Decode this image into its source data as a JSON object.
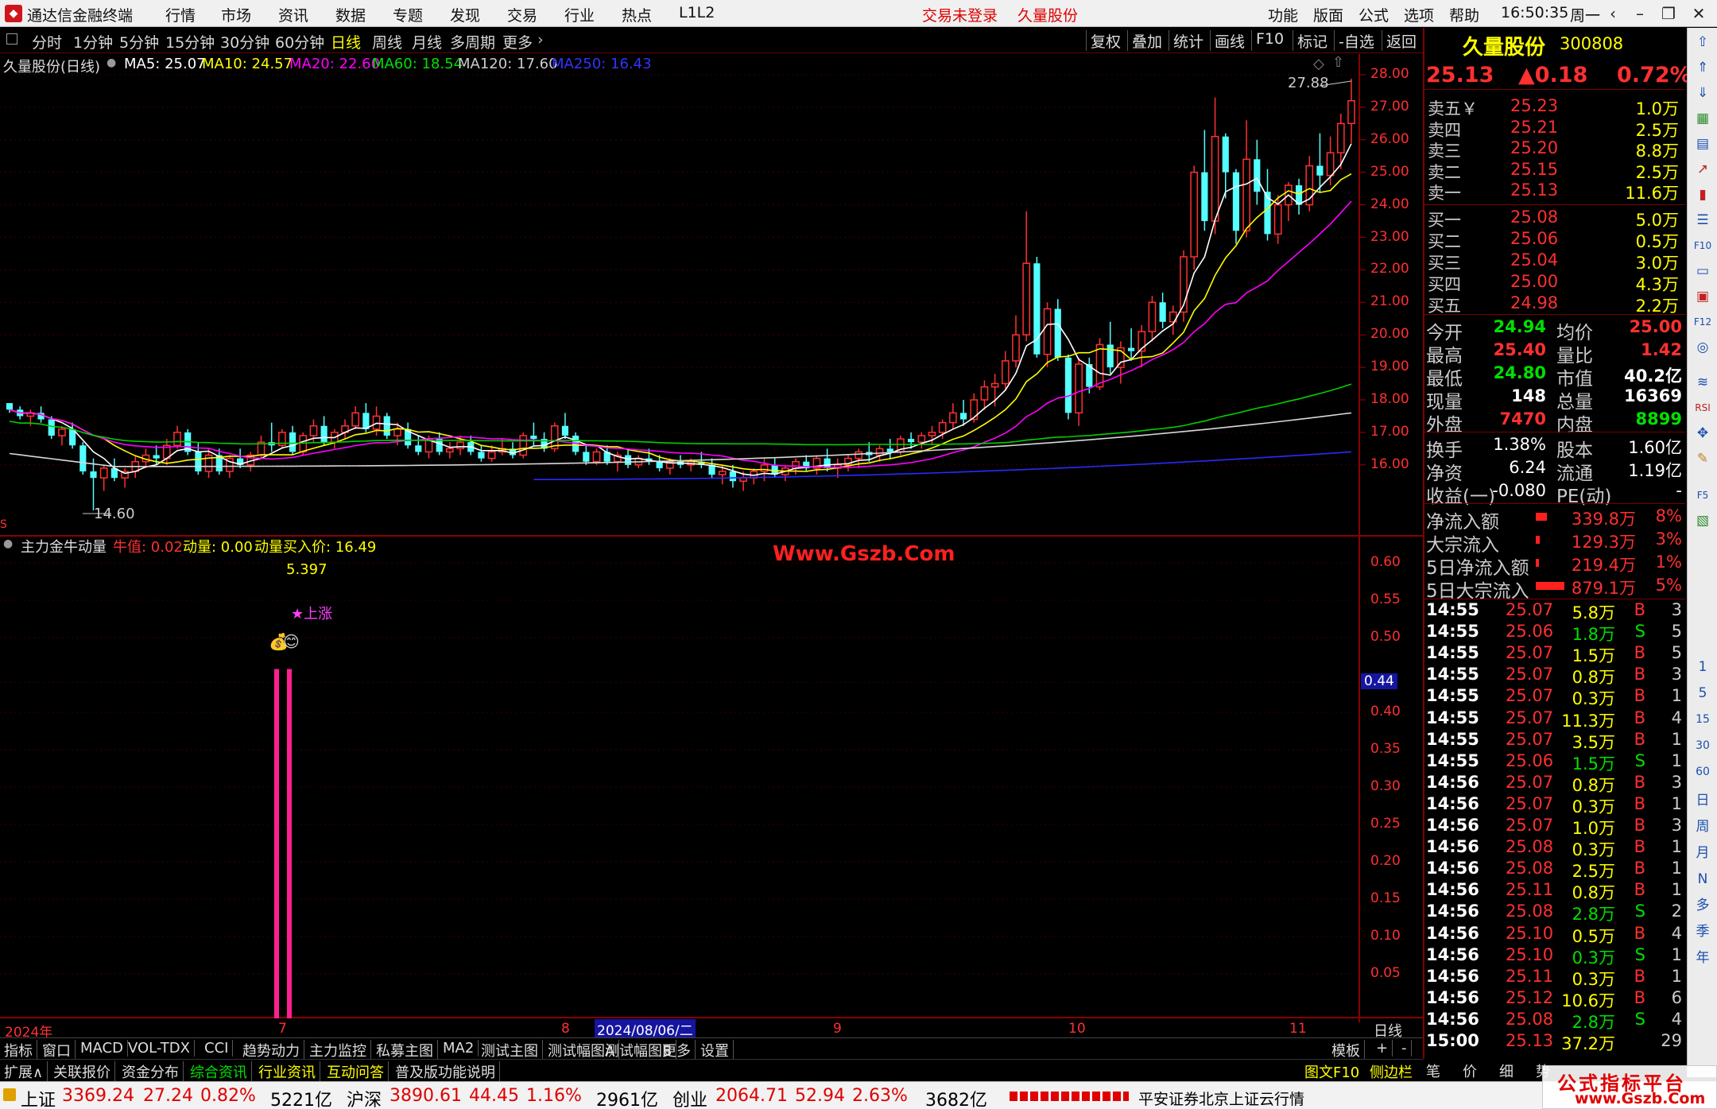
{
  "app": {
    "title": "通达信金融终端",
    "menu": [
      "行情",
      "市场",
      "资讯",
      "数据",
      "专题",
      "发现",
      "交易",
      "行业",
      "热点",
      "L1L2"
    ],
    "trade_status": "交易未登录",
    "stock_name_top": "久量股份",
    "right_menu": [
      "功能",
      "版面",
      "公式",
      "选项",
      "帮助"
    ],
    "time": "16:50:35",
    "weekday": "周一"
  },
  "toolbar": {
    "periods": [
      "分时",
      "1分钟",
      "5分钟",
      "15分钟",
      "30分钟",
      "60分钟",
      "日线",
      "周线",
      "月线",
      "多周期",
      "更多"
    ],
    "active_period": "日线",
    "right_buttons": [
      "复权",
      "叠加",
      "统计",
      "画线",
      "F10",
      "标记",
      "-自选",
      "返回"
    ]
  },
  "chart": {
    "header_name": "久量股份(日线)",
    "ma": [
      {
        "label": "MA5: 25.07",
        "color": "#ffffff"
      },
      {
        "label": "MA10: 24.57",
        "color": "#ffff00"
      },
      {
        "label": "MA20: 22.60",
        "color": "#ff00ff"
      },
      {
        "label": "MA60: 18.54",
        "color": "#00e000"
      },
      {
        "label": "MA120: 17.60",
        "color": "#cccccc"
      },
      {
        "label": "MA250: 16.43",
        "color": "#3333ff"
      }
    ],
    "high_label": "27.88",
    "low_label": "14.60",
    "price_axis": [
      "28.00",
      "27.00",
      "26.00",
      "25.00",
      "24.00",
      "23.00",
      "22.00",
      "21.00",
      "20.00",
      "19.00",
      "18.00",
      "17.00",
      "16.00"
    ],
    "indicator_name": "主力金牛动量",
    "indicator_items": [
      {
        "label": "牛值: 0.02",
        "color": "#ff3030"
      },
      {
        "label": "动量: 0.00",
        "color": "#ffff00"
      },
      {
        "label": "动量买入价: 16.49",
        "color": "#ffff00"
      }
    ],
    "indicator_value_top": "5.397",
    "signal_text": "★上涨",
    "watermark": "Www.Gszb.Com",
    "indicator_axis": [
      "0.60",
      "0.55",
      "0.50",
      "0.44",
      "0.40",
      "0.35",
      "0.30",
      "0.25",
      "0.20",
      "0.15",
      "0.10",
      "0.05"
    ],
    "indicator_current": "0.44",
    "date_axis": [
      "2024年",
      "7",
      "8",
      "9",
      "10",
      "11"
    ],
    "date_cursor": "2024/08/06/二",
    "period_label": "日线"
  },
  "quote": {
    "name": "久量股份",
    "code": "300808",
    "price": "25.13",
    "change": "▲0.18",
    "change_pct": "0.72%",
    "asks": [
      {
        "label": "卖五￥",
        "price": "25.23",
        "vol": "1.0万"
      },
      {
        "label": "卖四",
        "price": "25.21",
        "vol": "2.5万"
      },
      {
        "label": "卖三",
        "price": "25.20",
        "vol": "8.8万"
      },
      {
        "label": "卖二",
        "price": "25.15",
        "vol": "2.5万"
      },
      {
        "label": "卖一",
        "price": "25.13",
        "vol": "11.6万"
      }
    ],
    "bids": [
      {
        "label": "买一",
        "price": "25.08",
        "vol": "5.0万"
      },
      {
        "label": "买二",
        "price": "25.06",
        "vol": "0.5万"
      },
      {
        "label": "买三",
        "price": "25.04",
        "vol": "3.0万"
      },
      {
        "label": "买四",
        "price": "25.00",
        "vol": "4.3万"
      },
      {
        "label": "买五",
        "price": "24.98",
        "vol": "2.2万"
      }
    ],
    "stats": [
      {
        "k1": "今开",
        "v1": "24.94",
        "c1": "#00e000",
        "k2": "均价",
        "v2": "25.00",
        "c2": "#ff3030"
      },
      {
        "k1": "最高",
        "v1": "25.40",
        "c1": "#ff3030",
        "k2": "量比",
        "v2": "1.42",
        "c2": "#ff3030"
      },
      {
        "k1": "最低",
        "v1": "24.80",
        "c1": "#00e000",
        "k2": "市值",
        "v2": "40.2亿",
        "c2": "#ffffff"
      },
      {
        "k1": "现量",
        "v1": "148",
        "c1": "#ffffff",
        "k2": "总量",
        "v2": "16369",
        "c2": "#ffffff"
      },
      {
        "k1": "外盘",
        "v1": "7470",
        "c1": "#ff3030",
        "k2": "内盘",
        "v2": "8899",
        "c2": "#00e000"
      }
    ],
    "stats2": [
      {
        "k1": "换手",
        "v1": "1.38%",
        "k2": "股本",
        "v2": "1.60亿"
      },
      {
        "k1": "净资",
        "v1": "6.24",
        "k2": "流通",
        "v2": "1.19亿"
      },
      {
        "k1": "收益(一)",
        "v1": "-0.080",
        "k2": "PE(动)",
        "v2": "-"
      }
    ],
    "flows": [
      {
        "label": "净流入额",
        "value": "339.8万",
        "pct": "8%",
        "bar": 0.24
      },
      {
        "label": "大宗流入",
        "value": "129.3万",
        "pct": "3%",
        "bar": 0.09
      },
      {
        "label": "5日净流入额",
        "value": "219.4万",
        "pct": "1%",
        "bar": 0.03
      },
      {
        "label": "5日大宗流入",
        "value": "879.1万",
        "pct": "5%",
        "bar": 0.6
      }
    ],
    "ticks": [
      {
        "t": "14:55",
        "p": "25.07",
        "v": "5.8万",
        "s": "B",
        "n": "3"
      },
      {
        "t": "14:55",
        "p": "25.06",
        "v": "1.8万",
        "s": "S",
        "n": "5"
      },
      {
        "t": "14:55",
        "p": "25.07",
        "v": "1.5万",
        "s": "B",
        "n": "5"
      },
      {
        "t": "14:55",
        "p": "25.07",
        "v": "0.8万",
        "s": "B",
        "n": "3"
      },
      {
        "t": "14:55",
        "p": "25.07",
        "v": "0.3万",
        "s": "B",
        "n": "1"
      },
      {
        "t": "14:55",
        "p": "25.07",
        "v": "11.3万",
        "s": "B",
        "n": "4"
      },
      {
        "t": "14:55",
        "p": "25.07",
        "v": "3.5万",
        "s": "B",
        "n": "1"
      },
      {
        "t": "14:55",
        "p": "25.06",
        "v": "1.5万",
        "s": "S",
        "n": "1"
      },
      {
        "t": "14:56",
        "p": "25.07",
        "v": "0.8万",
        "s": "B",
        "n": "3"
      },
      {
        "t": "14:56",
        "p": "25.07",
        "v": "0.3万",
        "s": "B",
        "n": "1"
      },
      {
        "t": "14:56",
        "p": "25.07",
        "v": "1.0万",
        "s": "B",
        "n": "3"
      },
      {
        "t": "14:56",
        "p": "25.08",
        "v": "0.3万",
        "s": "B",
        "n": "1"
      },
      {
        "t": "14:56",
        "p": "25.08",
        "v": "2.5万",
        "s": "B",
        "n": "1"
      },
      {
        "t": "14:56",
        "p": "25.11",
        "v": "0.8万",
        "s": "B",
        "n": "1"
      },
      {
        "t": "14:56",
        "p": "25.08",
        "v": "2.8万",
        "s": "S",
        "n": "2"
      },
      {
        "t": "14:56",
        "p": "25.10",
        "v": "0.5万",
        "s": "B",
        "n": "4"
      },
      {
        "t": "14:56",
        "p": "25.10",
        "v": "0.3万",
        "s": "S",
        "n": "1"
      },
      {
        "t": "14:56",
        "p": "25.11",
        "v": "0.3万",
        "s": "B",
        "n": "1"
      },
      {
        "t": "14:56",
        "p": "25.12",
        "v": "10.6万",
        "s": "B",
        "n": "6"
      },
      {
        "t": "14:56",
        "p": "25.08",
        "v": "2.8万",
        "s": "S",
        "n": "4"
      },
      {
        "t": "15:00",
        "p": "25.13",
        "v": "37.2万",
        "s": "",
        "n": "29"
      }
    ]
  },
  "vtools": [
    "日",
    "周",
    "月",
    "N",
    "多",
    "季",
    "年",
    "1",
    "5",
    "15",
    "30",
    "60"
  ],
  "tabs1": [
    "指标",
    "窗口",
    "MACD",
    "VOL-TDX",
    "CCI",
    "趋势动力",
    "主力监控",
    "私募主图",
    "MA2",
    "测试主图",
    "测试幅图A",
    "测试幅图B",
    "更多",
    "设置"
  ],
  "tabs1_right": [
    "模板",
    "+",
    "-"
  ],
  "tabs2": [
    "扩展∧",
    "关联报价",
    "资金分布",
    "综合资讯",
    "行业资讯",
    "互动问答",
    "普及版功能说明"
  ],
  "tabs2_right": [
    "图文F10",
    "侧边栏《",
    "笔",
    "价",
    "细",
    "势"
  ],
  "status": {
    "sh_label": "上证",
    "sh_val": "3369.24",
    "sh_chg": "27.24",
    "sh_pct": "0.82%",
    "sh_amt": "5221亿",
    "hs_label": "沪深",
    "hs_val": "3890.61",
    "hs_chg": "44.45",
    "hs_pct": "1.16%",
    "hs_amt": "2961亿",
    "cy_label": "创业",
    "cy_val": "2064.71",
    "cy_chg": "52.94",
    "cy_pct": "2.63%",
    "cy_amt": "3682亿",
    "broker": "平安证券北京上证云行情",
    "site_title": "公式指标平台",
    "site_url": "www.Gszb.Com"
  },
  "chart_data": {
    "type": "candlestick",
    "ylim": [
      14.5,
      28.2
    ],
    "ohlc": [
      [
        17.9,
        17.9,
        17.6,
        17.7
      ],
      [
        17.7,
        17.8,
        17.4,
        17.5
      ],
      [
        17.5,
        17.7,
        17.2,
        17.6
      ],
      [
        17.6,
        17.8,
        17.3,
        17.4
      ],
      [
        17.4,
        17.5,
        16.8,
        16.9
      ],
      [
        16.9,
        17.2,
        16.6,
        17.1
      ],
      [
        17.1,
        17.3,
        16.5,
        16.6
      ],
      [
        16.6,
        16.7,
        15.7,
        15.8
      ],
      [
        15.8,
        16.2,
        14.6,
        15.6
      ],
      [
        15.6,
        16.0,
        15.2,
        15.9
      ],
      [
        15.9,
        16.2,
        15.5,
        15.6
      ],
      [
        15.6,
        15.9,
        15.3,
        15.8
      ],
      [
        15.8,
        16.3,
        15.6,
        16.1
      ],
      [
        16.1,
        16.5,
        15.9,
        16.3
      ],
      [
        16.3,
        16.6,
        16.0,
        16.2
      ],
      [
        16.2,
        16.8,
        16.0,
        16.6
      ],
      [
        16.6,
        17.2,
        16.5,
        17.0
      ],
      [
        17.0,
        17.1,
        16.3,
        16.4
      ],
      [
        16.4,
        16.7,
        15.7,
        15.8
      ],
      [
        15.8,
        16.5,
        15.6,
        16.3
      ],
      [
        16.3,
        16.5,
        15.7,
        15.8
      ],
      [
        15.8,
        16.3,
        15.6,
        16.2
      ],
      [
        16.2,
        16.5,
        15.9,
        16.0
      ],
      [
        16.0,
        16.4,
        15.8,
        16.3
      ],
      [
        16.3,
        16.9,
        16.2,
        16.7
      ],
      [
        16.7,
        17.3,
        16.4,
        16.6
      ],
      [
        16.6,
        17.1,
        16.5,
        17.0
      ],
      [
        17.0,
        17.2,
        16.3,
        16.4
      ],
      [
        16.4,
        17.0,
        16.3,
        16.9
      ],
      [
        16.9,
        17.4,
        16.7,
        17.2
      ],
      [
        17.2,
        17.5,
        16.6,
        16.7
      ],
      [
        16.7,
        17.1,
        16.5,
        17.0
      ],
      [
        17.0,
        17.4,
        16.8,
        17.2
      ],
      [
        17.2,
        17.8,
        17.1,
        17.6
      ],
      [
        17.6,
        17.9,
        17.0,
        17.1
      ],
      [
        17.1,
        17.8,
        16.9,
        17.5
      ],
      [
        17.5,
        17.6,
        16.8,
        16.9
      ],
      [
        16.9,
        17.3,
        16.6,
        17.1
      ],
      [
        17.1,
        17.3,
        16.5,
        16.6
      ],
      [
        16.6,
        16.9,
        16.3,
        16.4
      ],
      [
        16.4,
        16.9,
        16.2,
        16.8
      ],
      [
        16.8,
        17.0,
        16.3,
        16.4
      ],
      [
        16.4,
        16.7,
        16.2,
        16.5
      ],
      [
        16.5,
        16.9,
        16.3,
        16.7
      ],
      [
        16.7,
        16.9,
        16.3,
        16.4
      ],
      [
        16.4,
        16.6,
        16.1,
        16.2
      ],
      [
        16.2,
        16.6,
        16.1,
        16.4
      ],
      [
        16.4,
        16.8,
        16.3,
        16.5
      ],
      [
        16.5,
        16.7,
        16.2,
        16.3
      ],
      [
        16.3,
        17.0,
        16.2,
        16.9
      ],
      [
        16.9,
        17.3,
        16.6,
        16.8
      ],
      [
        16.8,
        17.0,
        16.4,
        16.5
      ],
      [
        16.5,
        17.3,
        16.4,
        17.2
      ],
      [
        17.2,
        17.6,
        16.8,
        16.9
      ],
      [
        16.9,
        17.0,
        16.3,
        16.4
      ],
      [
        16.4,
        16.6,
        16.0,
        16.1
      ],
      [
        16.1,
        16.5,
        16.0,
        16.4
      ],
      [
        16.4,
        16.6,
        16.0,
        16.1
      ],
      [
        16.1,
        16.4,
        15.8,
        16.3
      ],
      [
        16.3,
        16.5,
        15.9,
        16.0
      ],
      [
        16.0,
        16.3,
        15.9,
        16.2
      ],
      [
        16.2,
        16.5,
        16.0,
        16.1
      ],
      [
        16.1,
        16.3,
        15.8,
        15.9
      ],
      [
        15.9,
        16.2,
        15.7,
        16.1
      ],
      [
        16.1,
        16.3,
        15.9,
        16.0
      ],
      [
        16.0,
        16.2,
        15.8,
        16.1
      ],
      [
        16.1,
        16.4,
        15.9,
        16.0
      ],
      [
        16.0,
        16.2,
        15.6,
        15.7
      ],
      [
        15.7,
        16.0,
        15.4,
        15.8
      ],
      [
        15.8,
        16.0,
        15.3,
        15.5
      ],
      [
        15.5,
        15.8,
        15.2,
        15.6
      ],
      [
        15.6,
        15.9,
        15.4,
        15.8
      ],
      [
        15.8,
        16.2,
        15.5,
        16.0
      ],
      [
        16.0,
        16.2,
        15.6,
        15.7
      ],
      [
        15.7,
        16.0,
        15.5,
        15.9
      ],
      [
        15.9,
        16.2,
        15.7,
        16.1
      ],
      [
        16.1,
        16.3,
        15.8,
        15.9
      ],
      [
        15.9,
        16.3,
        15.7,
        16.2
      ],
      [
        16.2,
        16.5,
        15.8,
        15.9
      ],
      [
        15.9,
        16.2,
        15.6,
        16.0
      ],
      [
        16.0,
        16.3,
        15.8,
        16.2
      ],
      [
        16.2,
        16.5,
        15.9,
        16.4
      ],
      [
        16.4,
        16.7,
        16.1,
        16.3
      ],
      [
        16.3,
        16.6,
        16.1,
        16.5
      ],
      [
        16.5,
        16.8,
        16.2,
        16.4
      ],
      [
        16.4,
        16.9,
        16.3,
        16.8
      ],
      [
        16.8,
        17.0,
        16.5,
        16.7
      ],
      [
        16.7,
        17.0,
        16.5,
        16.9
      ],
      [
        16.9,
        17.2,
        16.6,
        17.0
      ],
      [
        17.0,
        17.4,
        16.8,
        17.3
      ],
      [
        17.3,
        17.9,
        17.1,
        17.6
      ],
      [
        17.6,
        18.0,
        17.2,
        17.4
      ],
      [
        17.4,
        18.2,
        17.3,
        18.0
      ],
      [
        18.0,
        18.6,
        17.7,
        18.4
      ],
      [
        18.4,
        18.8,
        17.8,
        18.5
      ],
      [
        18.5,
        19.5,
        18.3,
        19.2
      ],
      [
        19.2,
        20.6,
        19.0,
        20.0
      ],
      [
        20.0,
        23.8,
        19.8,
        22.2
      ],
      [
        22.2,
        22.4,
        19.3,
        19.4
      ],
      [
        19.4,
        21.0,
        19.0,
        20.8
      ],
      [
        20.8,
        21.1,
        19.2,
        19.3
      ],
      [
        19.3,
        19.4,
        17.4,
        17.6
      ],
      [
        17.6,
        19.3,
        17.2,
        19.1
      ],
      [
        19.1,
        19.3,
        18.2,
        18.4
      ],
      [
        18.4,
        19.9,
        18.3,
        19.7
      ],
      [
        19.7,
        20.4,
        18.8,
        19.0
      ],
      [
        19.0,
        19.8,
        18.5,
        19.6
      ],
      [
        19.6,
        20.2,
        19.2,
        19.5
      ],
      [
        19.5,
        20.3,
        19.0,
        20.1
      ],
      [
        20.1,
        21.2,
        19.8,
        21.0
      ],
      [
        21.0,
        21.3,
        20.2,
        20.4
      ],
      [
        20.4,
        20.9,
        20.0,
        20.7
      ],
      [
        20.7,
        22.6,
        20.4,
        22.4
      ],
      [
        22.4,
        25.2,
        22.0,
        25.0
      ],
      [
        25.0,
        26.3,
        23.2,
        23.5
      ],
      [
        23.5,
        27.3,
        23.1,
        26.1
      ],
      [
        26.1,
        26.2,
        24.2,
        25.0
      ],
      [
        25.0,
        25.1,
        22.8,
        23.2
      ],
      [
        23.2,
        26.6,
        23.0,
        25.4
      ],
      [
        25.4,
        26.0,
        24.0,
        24.4
      ],
      [
        24.4,
        25.1,
        22.9,
        23.1
      ],
      [
        23.1,
        24.3,
        22.8,
        24.0
      ],
      [
        24.0,
        24.7,
        23.5,
        24.6
      ],
      [
        24.6,
        24.8,
        23.7,
        24.0
      ],
      [
        24.0,
        25.5,
        23.8,
        25.2
      ],
      [
        25.2,
        26.2,
        24.4,
        24.9
      ],
      [
        24.9,
        26.1,
        24.6,
        25.6
      ],
      [
        25.6,
        26.8,
        25.1,
        26.5
      ],
      [
        26.5,
        27.88,
        25.9,
        27.2
      ]
    ],
    "indicator_bars": [
      {
        "index": 36,
        "value": 0.5
      },
      {
        "index": 37,
        "value": 0.5
      }
    ]
  }
}
